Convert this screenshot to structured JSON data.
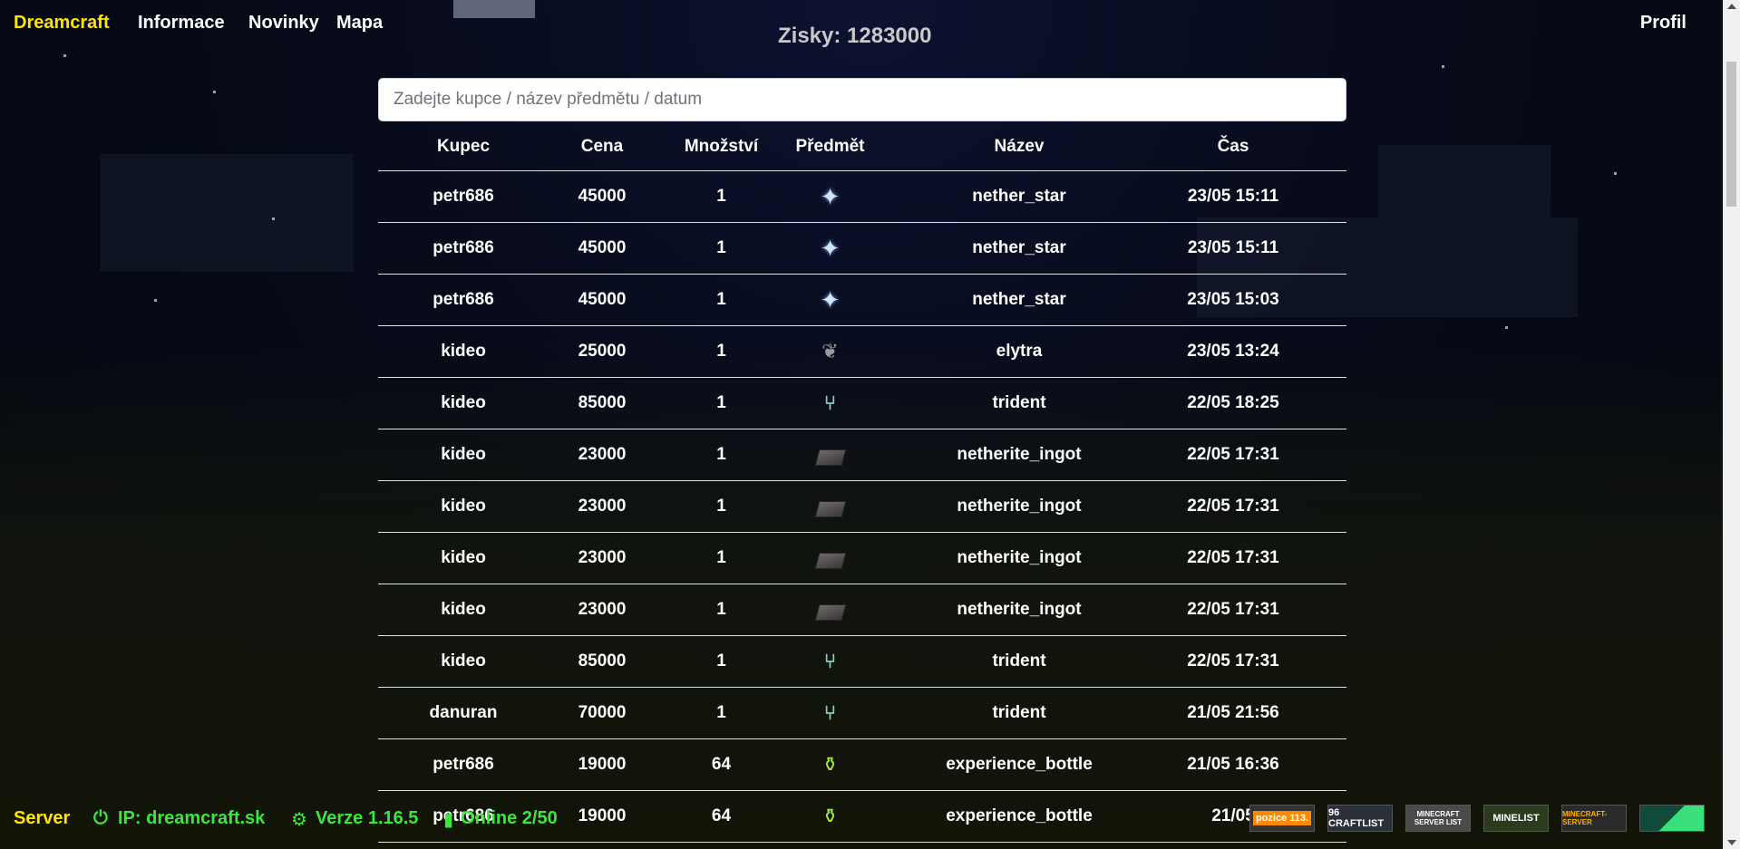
{
  "nav": {
    "brand": "Dreamcraft",
    "links": [
      "Informace",
      "Novinky",
      "Mapa"
    ],
    "profile": "Profil"
  },
  "zisky": "Zisky: 1283000",
  "search": {
    "placeholder": "Zadejte kupce / název předmětu / datum"
  },
  "table": {
    "headers": [
      "Kupec",
      "Cena",
      "Množství",
      "Předmět",
      "Název",
      "Čas"
    ],
    "rows": [
      {
        "buyer": "petr686",
        "price": "45000",
        "qty": "1",
        "icon": "nether-star-icon",
        "name": "nether_star",
        "time": "23/05 15:11"
      },
      {
        "buyer": "petr686",
        "price": "45000",
        "qty": "1",
        "icon": "nether-star-icon",
        "name": "nether_star",
        "time": "23/05 15:11"
      },
      {
        "buyer": "petr686",
        "price": "45000",
        "qty": "1",
        "icon": "nether-star-icon",
        "name": "nether_star",
        "time": "23/05 15:03"
      },
      {
        "buyer": "kideo",
        "price": "25000",
        "qty": "1",
        "icon": "elytra-icon",
        "name": "elytra",
        "time": "23/05 13:24"
      },
      {
        "buyer": "kideo",
        "price": "85000",
        "qty": "1",
        "icon": "trident-icon",
        "name": "trident",
        "time": "22/05 18:25"
      },
      {
        "buyer": "kideo",
        "price": "23000",
        "qty": "1",
        "icon": "netherite-ingot-icon",
        "name": "netherite_ingot",
        "time": "22/05 17:31"
      },
      {
        "buyer": "kideo",
        "price": "23000",
        "qty": "1",
        "icon": "netherite-ingot-icon",
        "name": "netherite_ingot",
        "time": "22/05 17:31"
      },
      {
        "buyer": "kideo",
        "price": "23000",
        "qty": "1",
        "icon": "netherite-ingot-icon",
        "name": "netherite_ingot",
        "time": "22/05 17:31"
      },
      {
        "buyer": "kideo",
        "price": "23000",
        "qty": "1",
        "icon": "netherite-ingot-icon",
        "name": "netherite_ingot",
        "time": "22/05 17:31"
      },
      {
        "buyer": "kideo",
        "price": "85000",
        "qty": "1",
        "icon": "trident-icon",
        "name": "trident",
        "time": "22/05 17:31"
      },
      {
        "buyer": "danuran",
        "price": "70000",
        "qty": "1",
        "icon": "trident-icon",
        "name": "trident",
        "time": "21/05 21:56"
      },
      {
        "buyer": "petr686",
        "price": "19000",
        "qty": "64",
        "icon": "experience-bottle-icon",
        "name": "experience_bottle",
        "time": "21/05 16:36"
      },
      {
        "buyer": "petr686",
        "price": "19000",
        "qty": "64",
        "icon": "experience-bottle-icon",
        "name": "experience_bottle",
        "time": "21/05"
      }
    ]
  },
  "footer": {
    "server": "Server",
    "ip": "IP: dreamcraft.sk",
    "version": "Verze 1.16.5",
    "online": "Online 2/50",
    "badges": [
      "pozice 113.",
      "96 CRAFTLIST",
      "MINECRAFT SERVER LIST",
      "MINELIST",
      "MINECRAFT-SERVER",
      ""
    ]
  },
  "colors": {
    "brand": "#ffe600",
    "footer_green": "#38e83a",
    "row_border": "#dee2e6"
  }
}
